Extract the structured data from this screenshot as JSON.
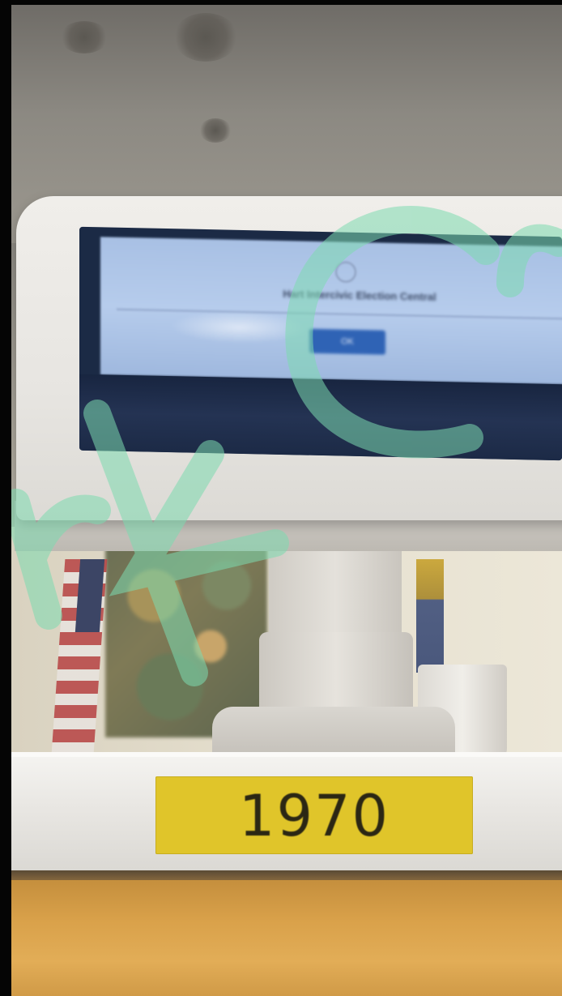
{
  "photo": {
    "kiosk_screen": {
      "title": "Hart Intercivic Election Central",
      "button_label": "OK"
    },
    "machine_label": "1970",
    "watermark": "ark CO"
  }
}
